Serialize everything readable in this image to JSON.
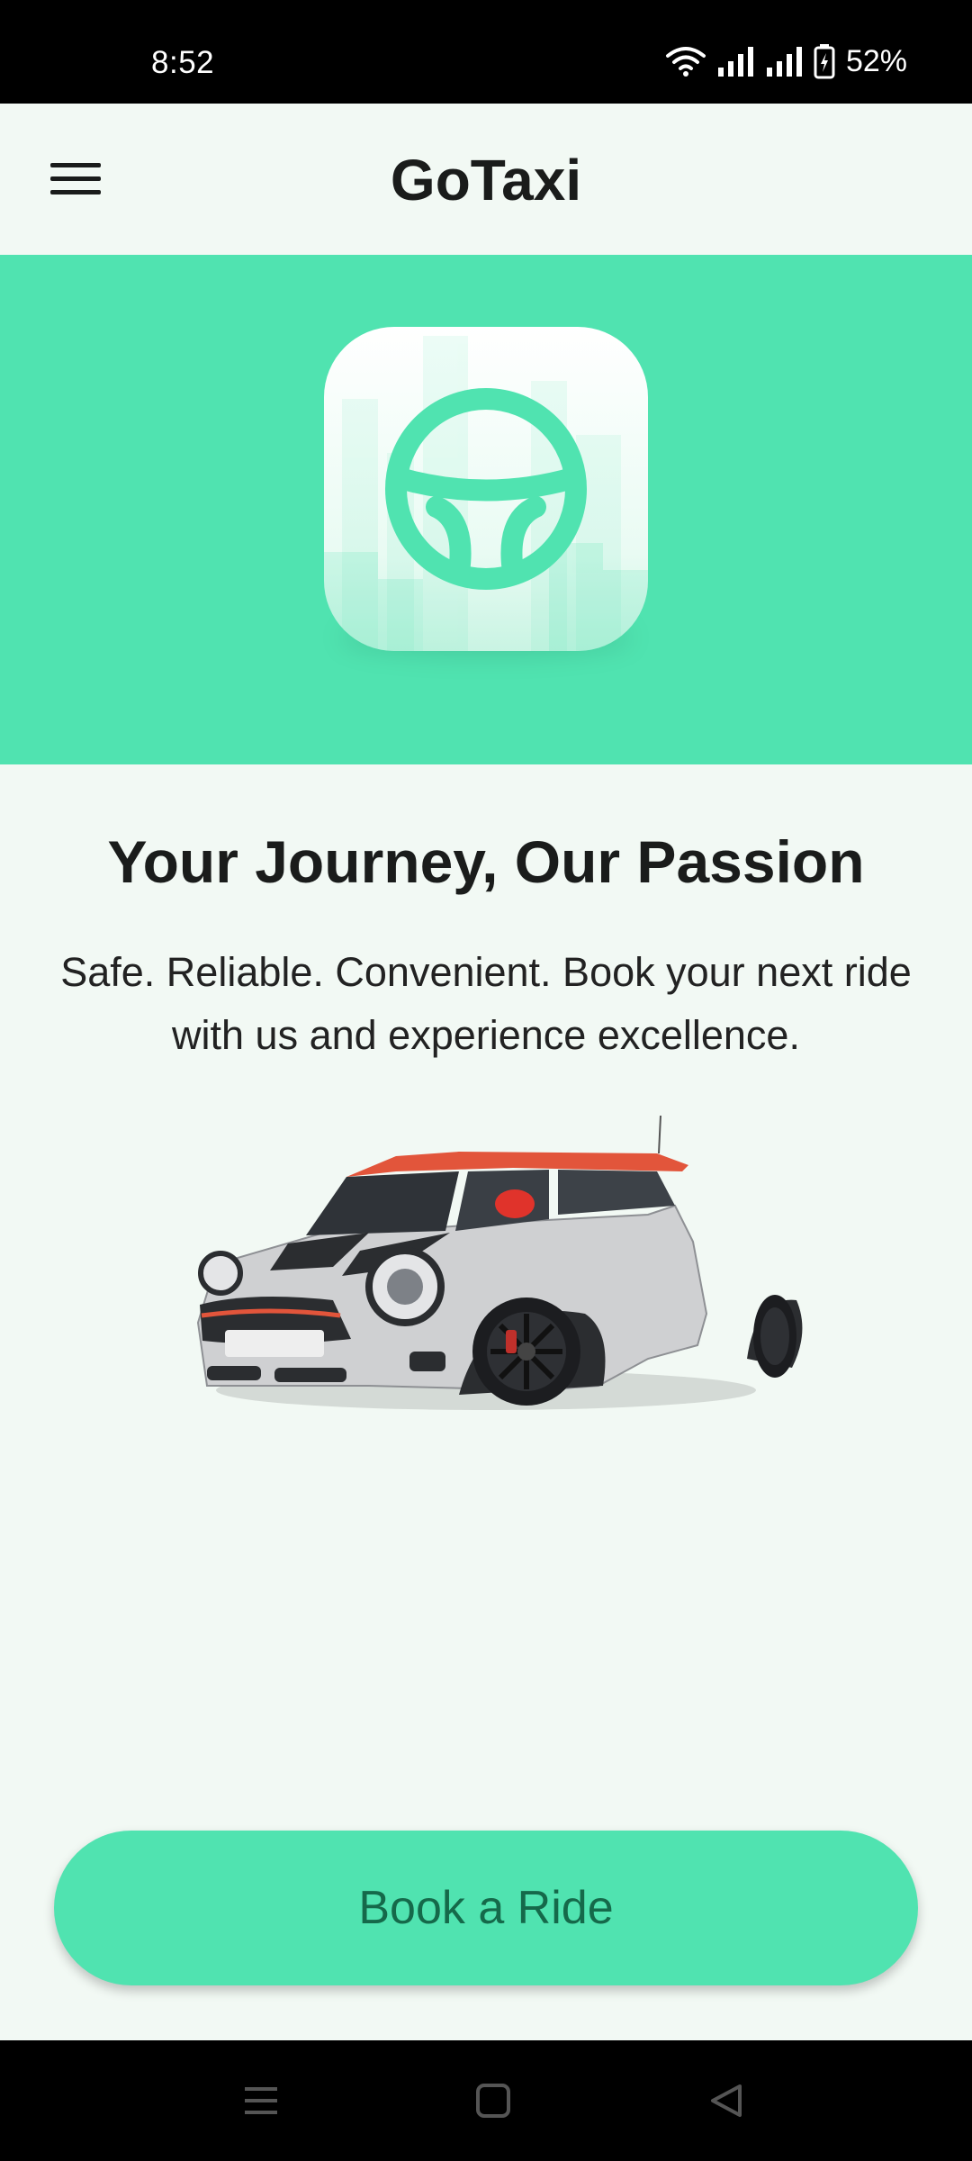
{
  "status_bar": {
    "time": "8:52",
    "battery": "52%",
    "icons": [
      "wifi-icon",
      "signal-icon",
      "signal-icon",
      "battery-icon"
    ]
  },
  "app_bar": {
    "title": "GoTaxi",
    "menu_icon": "hamburger-menu-icon"
  },
  "hero": {
    "logo_icon": "steering-wheel-icon",
    "background_color": "#50e3b0"
  },
  "main": {
    "headline": "Your Journey, Our Passion",
    "tagline": "Safe. Reliable. Convenient. Book your next ride with us and experience excellence.",
    "image": "car-image"
  },
  "cta": {
    "label": "Book a Ride",
    "background_color": "#50e3b0",
    "text_color": "#15694a"
  },
  "nav_bar": {
    "icons": [
      "recent-apps-icon",
      "home-icon",
      "back-icon"
    ]
  }
}
